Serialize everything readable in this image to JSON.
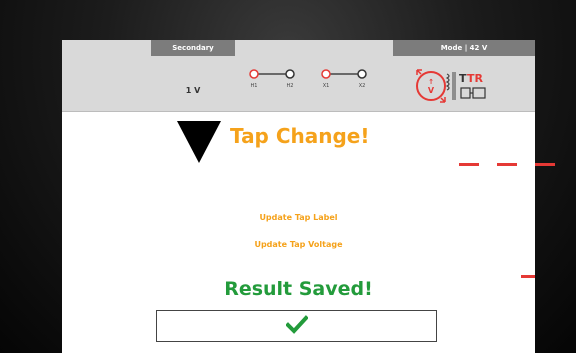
{
  "header": {
    "secondary_tab_label": "Secondary",
    "mode_tab_label": "Mode | 42 V",
    "voltage_readout": "1 V",
    "terminals": [
      {
        "label": "H1",
        "status_color": "#e53935"
      },
      {
        "label": "H2",
        "status_color": "#333333"
      },
      {
        "label": "X1",
        "status_color": "#e53935"
      },
      {
        "label": "X2",
        "status_color": "#333333"
      }
    ],
    "ttr_icon": {
      "name": "ttr-transformer-icon",
      "brand_text_black": "T",
      "brand_text_red": "TR"
    }
  },
  "main": {
    "tap_change_title": "Tap Change!",
    "tap_change_icon": "down-triangle-icon",
    "update_tap_label": "Update Tap Label",
    "update_tap_voltage": "Update Tap Voltage",
    "result_text": "Result Saved!",
    "confirm_icon": "checkmark-icon"
  },
  "colors": {
    "accent_orange": "#f5a21b",
    "success_green": "#239b3b",
    "header_gray": "#d9d9d9",
    "tab_gray": "#7c7c7c",
    "terminal_red": "#e53935"
  }
}
